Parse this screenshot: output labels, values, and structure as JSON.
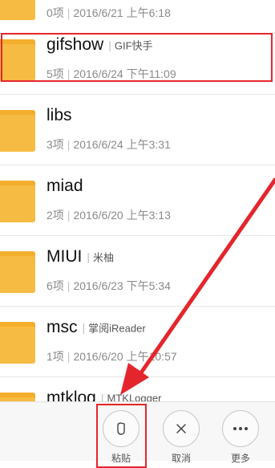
{
  "folders": [
    {
      "name": "",
      "alias": "",
      "count": "0项",
      "date": "2016/6/21 上午6:18"
    },
    {
      "name": "gifshow",
      "alias": "GIF快手",
      "count": "5项",
      "date": "2016/6/24 下午11:09"
    },
    {
      "name": "libs",
      "alias": "",
      "count": "3项",
      "date": "2016/6/24 上午3:31"
    },
    {
      "name": "miad",
      "alias": "",
      "count": "2项",
      "date": "2016/6/20 上午3:13"
    },
    {
      "name": "MIUI",
      "alias": "米柚",
      "count": "6项",
      "date": "2016/6/23 下午5:34"
    },
    {
      "name": "msc",
      "alias": "掌阅iReader",
      "count": "1项",
      "date": "2016/6/20 上午10:57"
    },
    {
      "name": "mtklog",
      "alias": "MTKLogger",
      "count": "",
      "date": ""
    }
  ],
  "actions": {
    "paste_label": "粘贴",
    "cancel_label": "取消",
    "more_label": "更多"
  },
  "colors": {
    "folder": "#F6BB42",
    "annotation_red": "#E5252C"
  }
}
